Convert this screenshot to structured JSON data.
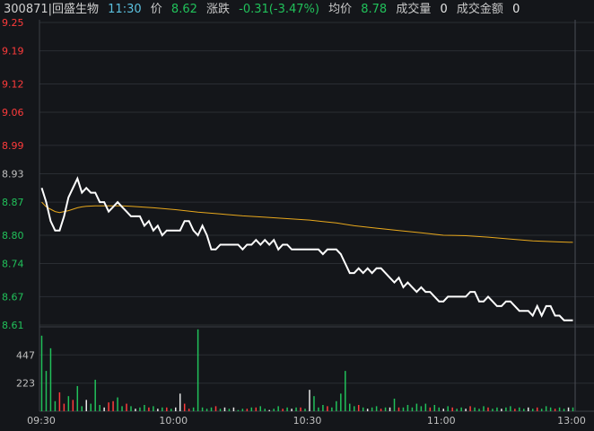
{
  "infobar": {
    "code_name": "300871|回盛生物",
    "time": "11:30",
    "price_label": "价",
    "price": "8.62",
    "change_label": "涨跌",
    "change": "-0.31(-3.47%)",
    "avg_label": "均价",
    "avg": "8.78",
    "volume_label": "成交量",
    "volume": "0",
    "amount_label": "成交金额",
    "amount": "0"
  },
  "colors": {
    "up": "#ff3b3b",
    "down": "#21c05a",
    "price_line": "#ffffff",
    "avg_line": "#e8a81c",
    "grid": "#2a2d33",
    "axis_text": "#c0c0c0",
    "time_text": "#5bc0de"
  },
  "chart_data": {
    "type": "line",
    "title": "",
    "price_axis": {
      "ticks": [
        "9.25",
        "9.19",
        "9.12",
        "9.06",
        "8.99",
        "8.93",
        "8.87",
        "8.80",
        "8.74",
        "8.67",
        "8.61"
      ],
      "ylim": [
        8.61,
        9.25
      ],
      "prev_close": 8.93
    },
    "volume_axis": {
      "ticks": [
        "447",
        "223"
      ],
      "ylim": [
        0,
        670
      ]
    },
    "time_axis": {
      "ticks": [
        "09:30",
        "10:00",
        "10:30",
        "11:00",
        "13:00"
      ],
      "xlim": [
        0,
        120
      ]
    },
    "series": [
      {
        "key": "price",
        "points": [
          [
            0,
            8.9
          ],
          [
            1,
            8.87
          ],
          [
            2,
            8.83
          ],
          [
            3,
            8.81
          ],
          [
            4,
            8.81
          ],
          [
            5,
            8.84
          ],
          [
            6,
            8.88
          ],
          [
            7,
            8.9
          ],
          [
            8,
            8.92
          ],
          [
            9,
            8.89
          ],
          [
            10,
            8.9
          ],
          [
            11,
            8.89
          ],
          [
            12,
            8.89
          ],
          [
            13,
            8.87
          ],
          [
            14,
            8.87
          ],
          [
            15,
            8.85
          ],
          [
            16,
            8.86
          ],
          [
            17,
            8.87
          ],
          [
            18,
            8.86
          ],
          [
            19,
            8.85
          ],
          [
            20,
            8.84
          ],
          [
            21,
            8.84
          ],
          [
            22,
            8.84
          ],
          [
            23,
            8.82
          ],
          [
            24,
            8.83
          ],
          [
            25,
            8.81
          ],
          [
            26,
            8.82
          ],
          [
            27,
            8.8
          ],
          [
            28,
            8.81
          ],
          [
            29,
            8.81
          ],
          [
            30,
            8.81
          ],
          [
            31,
            8.81
          ],
          [
            32,
            8.83
          ],
          [
            33,
            8.83
          ],
          [
            34,
            8.81
          ],
          [
            35,
            8.8
          ],
          [
            36,
            8.82
          ],
          [
            37,
            8.8
          ],
          [
            38,
            8.77
          ],
          [
            39,
            8.77
          ],
          [
            40,
            8.78
          ],
          [
            41,
            8.78
          ],
          [
            42,
            8.78
          ],
          [
            43,
            8.78
          ],
          [
            44,
            8.78
          ],
          [
            45,
            8.77
          ],
          [
            46,
            8.78
          ],
          [
            47,
            8.78
          ],
          [
            48,
            8.79
          ],
          [
            49,
            8.78
          ],
          [
            50,
            8.79
          ],
          [
            51,
            8.78
          ],
          [
            52,
            8.79
          ],
          [
            53,
            8.77
          ],
          [
            54,
            8.78
          ],
          [
            55,
            8.78
          ],
          [
            56,
            8.77
          ],
          [
            57,
            8.77
          ],
          [
            58,
            8.77
          ],
          [
            59,
            8.77
          ],
          [
            60,
            8.77
          ],
          [
            61,
            8.77
          ],
          [
            62,
            8.77
          ],
          [
            63,
            8.76
          ],
          [
            64,
            8.77
          ],
          [
            65,
            8.77
          ],
          [
            66,
            8.77
          ],
          [
            67,
            8.76
          ],
          [
            68,
            8.74
          ],
          [
            69,
            8.72
          ],
          [
            70,
            8.72
          ],
          [
            71,
            8.73
          ],
          [
            72,
            8.72
          ],
          [
            73,
            8.73
          ],
          [
            74,
            8.72
          ],
          [
            75,
            8.73
          ],
          [
            76,
            8.73
          ],
          [
            77,
            8.72
          ],
          [
            78,
            8.71
          ],
          [
            79,
            8.7
          ],
          [
            80,
            8.71
          ],
          [
            81,
            8.69
          ],
          [
            82,
            8.7
          ],
          [
            83,
            8.69
          ],
          [
            84,
            8.68
          ],
          [
            85,
            8.69
          ],
          [
            86,
            8.68
          ],
          [
            87,
            8.68
          ],
          [
            88,
            8.67
          ],
          [
            89,
            8.66
          ],
          [
            90,
            8.66
          ],
          [
            91,
            8.67
          ],
          [
            92,
            8.67
          ],
          [
            93,
            8.67
          ],
          [
            94,
            8.67
          ],
          [
            95,
            8.67
          ],
          [
            96,
            8.68
          ],
          [
            97,
            8.68
          ],
          [
            98,
            8.66
          ],
          [
            99,
            8.66
          ],
          [
            100,
            8.67
          ],
          [
            101,
            8.66
          ],
          [
            102,
            8.65
          ],
          [
            103,
            8.65
          ],
          [
            104,
            8.66
          ],
          [
            105,
            8.66
          ],
          [
            106,
            8.65
          ],
          [
            107,
            8.64
          ],
          [
            108,
            8.64
          ],
          [
            109,
            8.64
          ],
          [
            110,
            8.63
          ],
          [
            111,
            8.65
          ],
          [
            112,
            8.63
          ],
          [
            113,
            8.65
          ],
          [
            114,
            8.65
          ],
          [
            115,
            8.63
          ],
          [
            116,
            8.63
          ],
          [
            117,
            8.62
          ],
          [
            118,
            8.62
          ],
          [
            119,
            8.62
          ]
        ]
      },
      {
        "key": "average",
        "points": [
          [
            0,
            8.87
          ],
          [
            1,
            8.86
          ],
          [
            2,
            8.855
          ],
          [
            3,
            8.85
          ],
          [
            4,
            8.848
          ],
          [
            5,
            8.85
          ],
          [
            6,
            8.852
          ],
          [
            7,
            8.855
          ],
          [
            8,
            8.858
          ],
          [
            9,
            8.86
          ],
          [
            10,
            8.861
          ],
          [
            12,
            8.862
          ],
          [
            15,
            8.862
          ],
          [
            18,
            8.862
          ],
          [
            20,
            8.861
          ],
          [
            25,
            8.858
          ],
          [
            30,
            8.854
          ],
          [
            35,
            8.849
          ],
          [
            40,
            8.845
          ],
          [
            45,
            8.841
          ],
          [
            50,
            8.838
          ],
          [
            55,
            8.835
          ],
          [
            60,
            8.832
          ],
          [
            63,
            8.829
          ],
          [
            66,
            8.826
          ],
          [
            70,
            8.82
          ],
          [
            75,
            8.815
          ],
          [
            80,
            8.81
          ],
          [
            85,
            8.805
          ],
          [
            90,
            8.8
          ],
          [
            95,
            8.799
          ],
          [
            100,
            8.796
          ],
          [
            105,
            8.792
          ],
          [
            110,
            8.788
          ],
          [
            115,
            8.786
          ],
          [
            119,
            8.785
          ]
        ]
      }
    ],
    "volume": [
      {
        "x": 0,
        "v": 600,
        "dir": "down"
      },
      {
        "x": 1,
        "v": 320,
        "dir": "down"
      },
      {
        "x": 2,
        "v": 500,
        "dir": "down"
      },
      {
        "x": 3,
        "v": 80,
        "dir": "down"
      },
      {
        "x": 4,
        "v": 150,
        "dir": "up"
      },
      {
        "x": 5,
        "v": 60,
        "dir": "up"
      },
      {
        "x": 6,
        "v": 120,
        "dir": "down"
      },
      {
        "x": 7,
        "v": 90,
        "dir": "up"
      },
      {
        "x": 8,
        "v": 200,
        "dir": "down"
      },
      {
        "x": 9,
        "v": 40,
        "dir": "down"
      },
      {
        "x": 10,
        "v": 90,
        "dir": "flat"
      },
      {
        "x": 11,
        "v": 60,
        "dir": "down"
      },
      {
        "x": 12,
        "v": 250,
        "dir": "down"
      },
      {
        "x": 13,
        "v": 50,
        "dir": "down"
      },
      {
        "x": 14,
        "v": 30,
        "dir": "flat"
      },
      {
        "x": 15,
        "v": 70,
        "dir": "up"
      },
      {
        "x": 16,
        "v": 80,
        "dir": "up"
      },
      {
        "x": 17,
        "v": 110,
        "dir": "down"
      },
      {
        "x": 18,
        "v": 40,
        "dir": "down"
      },
      {
        "x": 19,
        "v": 60,
        "dir": "up"
      },
      {
        "x": 20,
        "v": 40,
        "dir": "down"
      },
      {
        "x": 21,
        "v": 20,
        "dir": "flat"
      },
      {
        "x": 22,
        "v": 30,
        "dir": "down"
      },
      {
        "x": 23,
        "v": 50,
        "dir": "down"
      },
      {
        "x": 24,
        "v": 30,
        "dir": "up"
      },
      {
        "x": 25,
        "v": 40,
        "dir": "down"
      },
      {
        "x": 26,
        "v": 20,
        "dir": "flat"
      },
      {
        "x": 27,
        "v": 30,
        "dir": "down"
      },
      {
        "x": 28,
        "v": 30,
        "dir": "up"
      },
      {
        "x": 29,
        "v": 20,
        "dir": "down"
      },
      {
        "x": 30,
        "v": 30,
        "dir": "flat"
      },
      {
        "x": 31,
        "v": 140,
        "dir": "flat"
      },
      {
        "x": 32,
        "v": 60,
        "dir": "up"
      },
      {
        "x": 33,
        "v": 20,
        "dir": "up"
      },
      {
        "x": 34,
        "v": 30,
        "dir": "down"
      },
      {
        "x": 35,
        "v": 650,
        "dir": "down"
      },
      {
        "x": 36,
        "v": 30,
        "dir": "down"
      },
      {
        "x": 37,
        "v": 20,
        "dir": "down"
      },
      {
        "x": 38,
        "v": 30,
        "dir": "down"
      },
      {
        "x": 39,
        "v": 40,
        "dir": "up"
      },
      {
        "x": 40,
        "v": 20,
        "dir": "down"
      },
      {
        "x": 41,
        "v": 30,
        "dir": "flat"
      },
      {
        "x": 42,
        "v": 20,
        "dir": "down"
      },
      {
        "x": 43,
        "v": 30,
        "dir": "flat"
      },
      {
        "x": 44,
        "v": 10,
        "dir": "down"
      },
      {
        "x": 45,
        "v": 20,
        "dir": "down"
      },
      {
        "x": 46,
        "v": 20,
        "dir": "up"
      },
      {
        "x": 47,
        "v": 30,
        "dir": "down"
      },
      {
        "x": 48,
        "v": 30,
        "dir": "up"
      },
      {
        "x": 49,
        "v": 40,
        "dir": "down"
      },
      {
        "x": 50,
        "v": 20,
        "dir": "down"
      },
      {
        "x": 51,
        "v": 10,
        "dir": "flat"
      },
      {
        "x": 52,
        "v": 20,
        "dir": "down"
      },
      {
        "x": 53,
        "v": 40,
        "dir": "down"
      },
      {
        "x": 54,
        "v": 20,
        "dir": "up"
      },
      {
        "x": 55,
        "v": 30,
        "dir": "down"
      },
      {
        "x": 56,
        "v": 20,
        "dir": "flat"
      },
      {
        "x": 57,
        "v": 30,
        "dir": "down"
      },
      {
        "x": 58,
        "v": 30,
        "dir": "up"
      },
      {
        "x": 59,
        "v": 20,
        "dir": "down"
      },
      {
        "x": 60,
        "v": 170,
        "dir": "flat"
      },
      {
        "x": 61,
        "v": 120,
        "dir": "down"
      },
      {
        "x": 62,
        "v": 30,
        "dir": "down"
      },
      {
        "x": 63,
        "v": 50,
        "dir": "down"
      },
      {
        "x": 64,
        "v": 40,
        "dir": "up"
      },
      {
        "x": 65,
        "v": 30,
        "dir": "down"
      },
      {
        "x": 66,
        "v": 80,
        "dir": "down"
      },
      {
        "x": 67,
        "v": 140,
        "dir": "down"
      },
      {
        "x": 68,
        "v": 320,
        "dir": "down"
      },
      {
        "x": 69,
        "v": 60,
        "dir": "down"
      },
      {
        "x": 70,
        "v": 40,
        "dir": "down"
      },
      {
        "x": 71,
        "v": 50,
        "dir": "up"
      },
      {
        "x": 72,
        "v": 30,
        "dir": "down"
      },
      {
        "x": 73,
        "v": 20,
        "dir": "flat"
      },
      {
        "x": 74,
        "v": 30,
        "dir": "down"
      },
      {
        "x": 75,
        "v": 40,
        "dir": "down"
      },
      {
        "x": 76,
        "v": 20,
        "dir": "up"
      },
      {
        "x": 77,
        "v": 30,
        "dir": "down"
      },
      {
        "x": 78,
        "v": 30,
        "dir": "flat"
      },
      {
        "x": 79,
        "v": 100,
        "dir": "down"
      },
      {
        "x": 80,
        "v": 30,
        "dir": "up"
      },
      {
        "x": 81,
        "v": 30,
        "dir": "down"
      },
      {
        "x": 82,
        "v": 50,
        "dir": "down"
      },
      {
        "x": 83,
        "v": 30,
        "dir": "down"
      },
      {
        "x": 84,
        "v": 60,
        "dir": "down"
      },
      {
        "x": 85,
        "v": 40,
        "dir": "down"
      },
      {
        "x": 86,
        "v": 60,
        "dir": "down"
      },
      {
        "x": 87,
        "v": 30,
        "dir": "up"
      },
      {
        "x": 88,
        "v": 50,
        "dir": "down"
      },
      {
        "x": 89,
        "v": 30,
        "dir": "down"
      },
      {
        "x": 90,
        "v": 20,
        "dir": "flat"
      },
      {
        "x": 91,
        "v": 40,
        "dir": "down"
      },
      {
        "x": 92,
        "v": 30,
        "dir": "up"
      },
      {
        "x": 93,
        "v": 20,
        "dir": "down"
      },
      {
        "x": 94,
        "v": 30,
        "dir": "down"
      },
      {
        "x": 95,
        "v": 20,
        "dir": "flat"
      },
      {
        "x": 96,
        "v": 40,
        "dir": "up"
      },
      {
        "x": 97,
        "v": 30,
        "dir": "down"
      },
      {
        "x": 98,
        "v": 20,
        "dir": "down"
      },
      {
        "x": 99,
        "v": 40,
        "dir": "down"
      },
      {
        "x": 100,
        "v": 30,
        "dir": "up"
      },
      {
        "x": 101,
        "v": 20,
        "dir": "down"
      },
      {
        "x": 102,
        "v": 30,
        "dir": "down"
      },
      {
        "x": 103,
        "v": 20,
        "dir": "flat"
      },
      {
        "x": 104,
        "v": 30,
        "dir": "down"
      },
      {
        "x": 105,
        "v": 40,
        "dir": "down"
      },
      {
        "x": 106,
        "v": 20,
        "dir": "up"
      },
      {
        "x": 107,
        "v": 30,
        "dir": "down"
      },
      {
        "x": 108,
        "v": 20,
        "dir": "down"
      },
      {
        "x": 109,
        "v": 30,
        "dir": "flat"
      },
      {
        "x": 110,
        "v": 20,
        "dir": "down"
      },
      {
        "x": 111,
        "v": 30,
        "dir": "up"
      },
      {
        "x": 112,
        "v": 20,
        "dir": "down"
      },
      {
        "x": 113,
        "v": 40,
        "dir": "down"
      },
      {
        "x": 114,
        "v": 30,
        "dir": "down"
      },
      {
        "x": 115,
        "v": 20,
        "dir": "up"
      },
      {
        "x": 116,
        "v": 30,
        "dir": "down"
      },
      {
        "x": 117,
        "v": 20,
        "dir": "down"
      },
      {
        "x": 118,
        "v": 30,
        "dir": "flat"
      },
      {
        "x": 119,
        "v": 30,
        "dir": "down"
      }
    ]
  }
}
